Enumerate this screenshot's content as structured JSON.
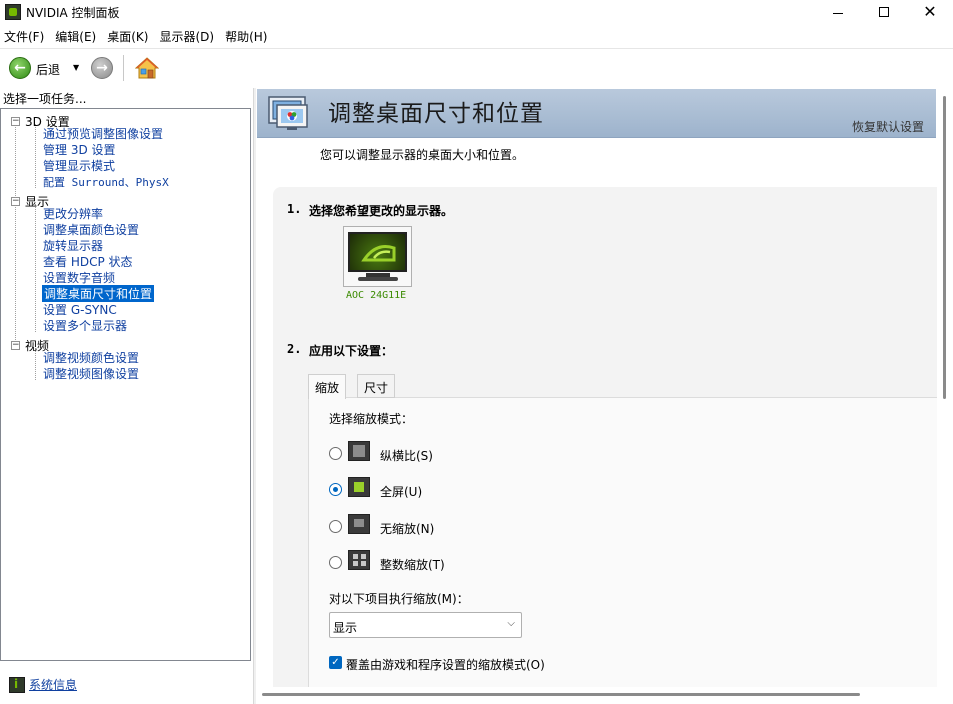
{
  "window": {
    "title": "NVIDIA 控制面板",
    "minimize": "–",
    "maximize": "□",
    "close": "✕"
  },
  "menu": [
    "文件(F)",
    "编辑(E)",
    "桌面(K)",
    "显示器(D)",
    "帮助(H)"
  ],
  "toolbar": {
    "back_label": "后退",
    "back_dropdown": "▼",
    "back_glyph": "←",
    "forward_glyph": "→"
  },
  "left_pane": {
    "title": "选择一项任务...",
    "tree": [
      {
        "label": "3D 设置",
        "expander": "−",
        "items": [
          "通过预览调整图像设置",
          "管理 3D 设置",
          "管理显示模式",
          "配置 Surround、PhysX"
        ]
      },
      {
        "label": "显示",
        "expander": "−",
        "items": [
          "更改分辨率",
          "调整桌面颜色设置",
          "旋转显示器",
          "查看 HDCP 状态",
          "设置数字音频",
          "调整桌面尺寸和位置",
          "设置 G-SYNC",
          "设置多个显示器"
        ]
      },
      {
        "label": "视频",
        "expander": "−",
        "items": [
          "调整视频颜色设置",
          "调整视频图像设置"
        ]
      }
    ],
    "selected_item": "调整桌面尺寸和位置",
    "system_info_link": "系统信息"
  },
  "main": {
    "title": "调整桌面尺寸和位置",
    "restore_defaults": "恢复默认设置",
    "subtitle": "您可以调整显示器的桌面大小和位置。",
    "section1": {
      "num": "1.",
      "label": "选择您希望更改的显示器。"
    },
    "monitor_name": "AOC 24G11E",
    "section2": {
      "num": "2.",
      "label": "应用以下设置："
    },
    "tabs": [
      "缩放",
      "尺寸"
    ],
    "active_tab": "缩放",
    "scaling_mode_label": "选择缩放模式：",
    "modes": [
      {
        "label": "纵横比(S)",
        "selected": false,
        "icon": "aspect-ratio-icon"
      },
      {
        "label": "全屏(U)",
        "selected": true,
        "icon": "fullscreen-icon"
      },
      {
        "label": "无缩放(N)",
        "selected": false,
        "icon": "no-scaling-icon"
      },
      {
        "label": "整数缩放(T)",
        "selected": false,
        "icon": "integer-scaling-icon"
      }
    ],
    "perform_on_label": "对以下项目执行缩放(M)：",
    "perform_on_value": "显示",
    "override_checkbox_label": "覆盖由游戏和程序设置的缩放模式(O)",
    "override_checked": true
  },
  "colors": {
    "nvidia_green": "#76b900",
    "link_blue": "#1040a0",
    "selection_blue": "#0066cc",
    "header_blue": "#a9bcd3",
    "accent": "#0067c0"
  }
}
